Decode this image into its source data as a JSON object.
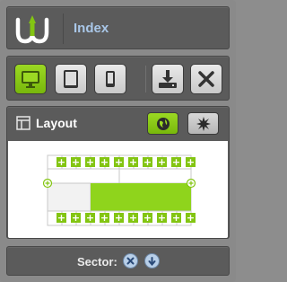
{
  "header": {
    "title": "Index",
    "logo": "w-logo-icon"
  },
  "toolbar": {
    "buttons": [
      {
        "icon": "desktop-icon",
        "active": true
      },
      {
        "icon": "tablet-icon",
        "active": false
      },
      {
        "icon": "phone-icon",
        "active": false
      },
      {
        "icon": "download-icon",
        "active": false
      },
      {
        "icon": "close-icon",
        "active": false
      }
    ]
  },
  "layout_panel": {
    "title": "Layout",
    "icons": [
      "layout-icon",
      "globe-icon",
      "burst-icon"
    ]
  },
  "sector": {
    "label": "Sector:",
    "icons": [
      "remove-icon",
      "down-arrow-icon"
    ]
  },
  "colors": {
    "accent": "#83c512",
    "panel": "#5b5b5b",
    "title": "#a9c7e8"
  }
}
